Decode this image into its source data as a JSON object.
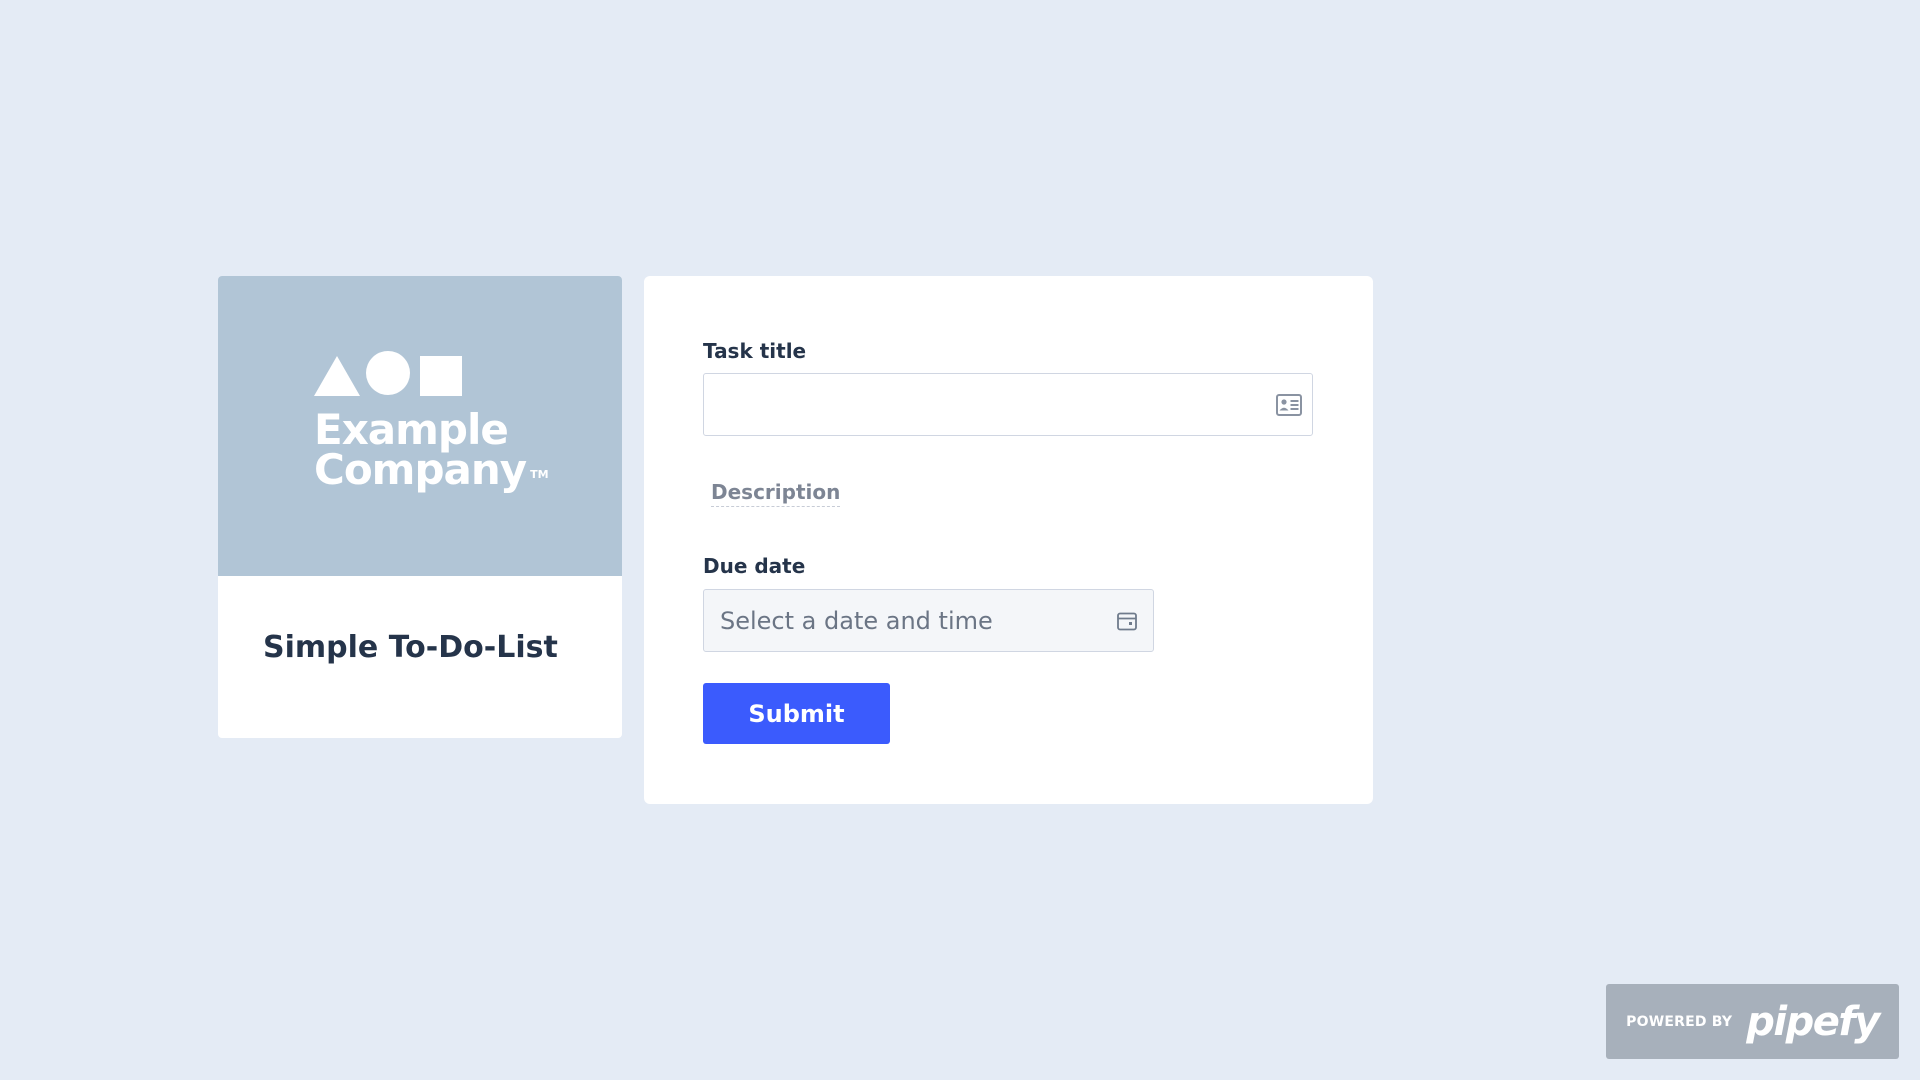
{
  "company": {
    "logo_line1": "Example",
    "logo_line2": "Company",
    "logo_tm": "TM",
    "pipe_title": "Simple To-Do-List",
    "banner_color": "#b1c5d6"
  },
  "form": {
    "fields": [
      {
        "label": "Task title",
        "type": "short-text",
        "value": "",
        "icon": "id-card-icon"
      },
      {
        "label": "Description",
        "type": "section-label"
      },
      {
        "label": "Due date",
        "type": "datetime",
        "placeholder": "Select a date and time",
        "icon": "calendar-icon"
      }
    ],
    "submit_label": "Submit",
    "submit_color": "#3b5bfd"
  },
  "footer": {
    "powered_by": "POWERED BY",
    "brand": "pipefy"
  }
}
